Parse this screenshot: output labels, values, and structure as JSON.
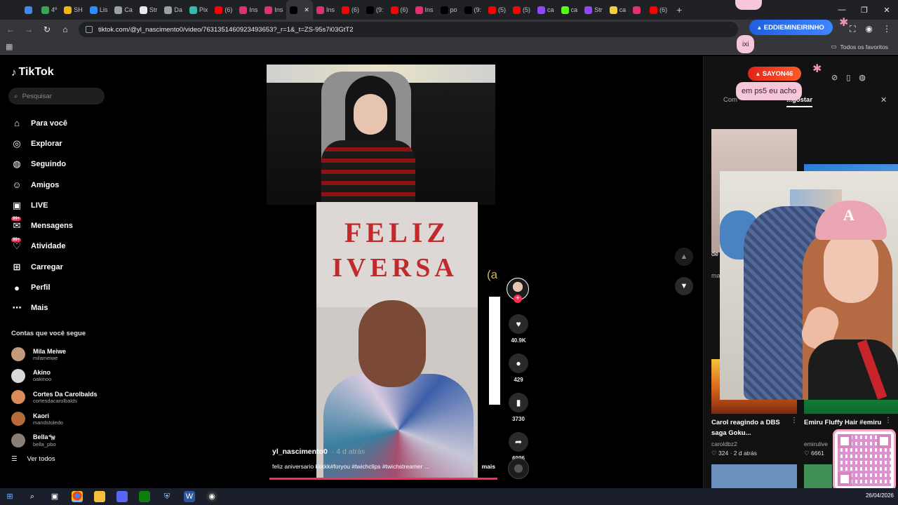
{
  "browser": {
    "tabs": [
      {
        "label": "",
        "color": "#4285f4"
      },
      {
        "label": "4º",
        "color": "#34a853"
      },
      {
        "label": "SH",
        "color": "#f4b400"
      },
      {
        "label": "Lis",
        "color": "#2d8cff"
      },
      {
        "label": "Ca",
        "color": "#9aa0a6"
      },
      {
        "label": "Str",
        "color": "#e8eaed"
      },
      {
        "label": "Da",
        "color": "#9aa0a6"
      },
      {
        "label": "Pix",
        "color": "#32bcad"
      },
      {
        "label": "(6)",
        "color": "#ff0000"
      },
      {
        "label": "Ins",
        "color": "#e1306c"
      },
      {
        "label": "Ins",
        "color": "#e1306c"
      },
      {
        "label": "",
        "color": "#000000",
        "active": true
      },
      {
        "label": "Ins",
        "color": "#e1306c"
      },
      {
        "label": "(6)",
        "color": "#ff0000"
      },
      {
        "label": "(9:",
        "color": "#000000"
      },
      {
        "label": "(6)",
        "color": "#ff0000"
      },
      {
        "label": "Ins",
        "color": "#e1306c"
      },
      {
        "label": "po",
        "color": "#000000"
      },
      {
        "label": "(9:",
        "color": "#000000"
      },
      {
        "label": "(5)",
        "color": "#ff0000"
      },
      {
        "label": "(5)",
        "color": "#ff0000"
      },
      {
        "label": "ca",
        "color": "#9146ff"
      },
      {
        "label": "ca",
        "color": "#53fc18"
      },
      {
        "label": "Str",
        "color": "#9146ff"
      },
      {
        "label": "ca",
        "color": "#f4d03f"
      },
      {
        "label": "",
        "color": "#e1306c"
      },
      {
        "label": "(6)",
        "color": "#ff0000"
      }
    ],
    "url": "tiktok.com/@yl_nascimento0/video/7631351460923493653?_r=1&_t=ZS-95s7i03GtT2",
    "favorites_label": "Todos os favoritos"
  },
  "sidebar": {
    "logo": "TikTok",
    "search_placeholder": "Pesquisar",
    "nav": [
      {
        "label": "Para você",
        "icon": "home-icon"
      },
      {
        "label": "Explorar",
        "icon": "compass-icon"
      },
      {
        "label": "Seguindo",
        "icon": "following-icon"
      },
      {
        "label": "Amigos",
        "icon": "friends-icon"
      },
      {
        "label": "LIVE",
        "icon": "live-icon"
      },
      {
        "label": "Mensagens",
        "icon": "messages-icon",
        "badge": "99+"
      },
      {
        "label": "Atividade",
        "icon": "activity-icon",
        "badge": "99+"
      },
      {
        "label": "Carregar",
        "icon": "upload-icon"
      },
      {
        "label": "Perfil",
        "icon": "profile-icon"
      },
      {
        "label": "Mais",
        "icon": "more-icon"
      }
    ],
    "following_title": "Contas que você segue",
    "accounts": [
      {
        "name": "Mila Meiwe",
        "handle": "milameiwe",
        "color": "#c49a7a"
      },
      {
        "name": "Akino",
        "handle": "oakinoo",
        "color": "#d9d9d9"
      },
      {
        "name": "Cortes Da Carolbalds",
        "handle": "cortesdacarolbalds",
        "color": "#d88c5a"
      },
      {
        "name": "Kaori",
        "handle": "mandstoledo",
        "color": "#b86b3a"
      },
      {
        "name": "Bella🐄",
        "handle": "bella_pbo",
        "color": "#8b7e74"
      }
    ],
    "see_all": "Ver todos"
  },
  "video": {
    "banner_line1": "FELIZ",
    "banner_line2": "IVERSA",
    "side_text": "(a",
    "creator": "yl_nascimento0",
    "ago": "· 4 d atrás",
    "caption": "feliz aniversario kkkkk#foryou #twichclips #twichstreamer ...",
    "more": "mais",
    "likes": "40.9K",
    "comments": "429",
    "saves": "3730",
    "shares": "6996"
  },
  "right_panel": {
    "tabs": [
      "Com",
      "...gostar"
    ],
    "videos": [
      {
        "title": "Carol reagindo a DBS saga Goku...",
        "author": "caroldbz2",
        "views": "324",
        "ago": "2 d atrás"
      },
      {
        "title": "Emiru Fluffy Hair #emiru",
        "author": "emirulive",
        "views": "6661",
        "ago": ""
      }
    ],
    "partial_texts": [
      "de",
      "ma"
    ]
  },
  "stream_overlay": {
    "chat": [
      {
        "user": "EDDIEMINEIRINHO",
        "message": "ixi",
        "color": "#1f5fe0"
      },
      {
        "user": "SAYON46",
        "message": "em ps5 eu acho",
        "color": "#e0241c"
      }
    ],
    "cap_logo": "A"
  },
  "taskbar": {
    "date": "26/04/2026"
  }
}
